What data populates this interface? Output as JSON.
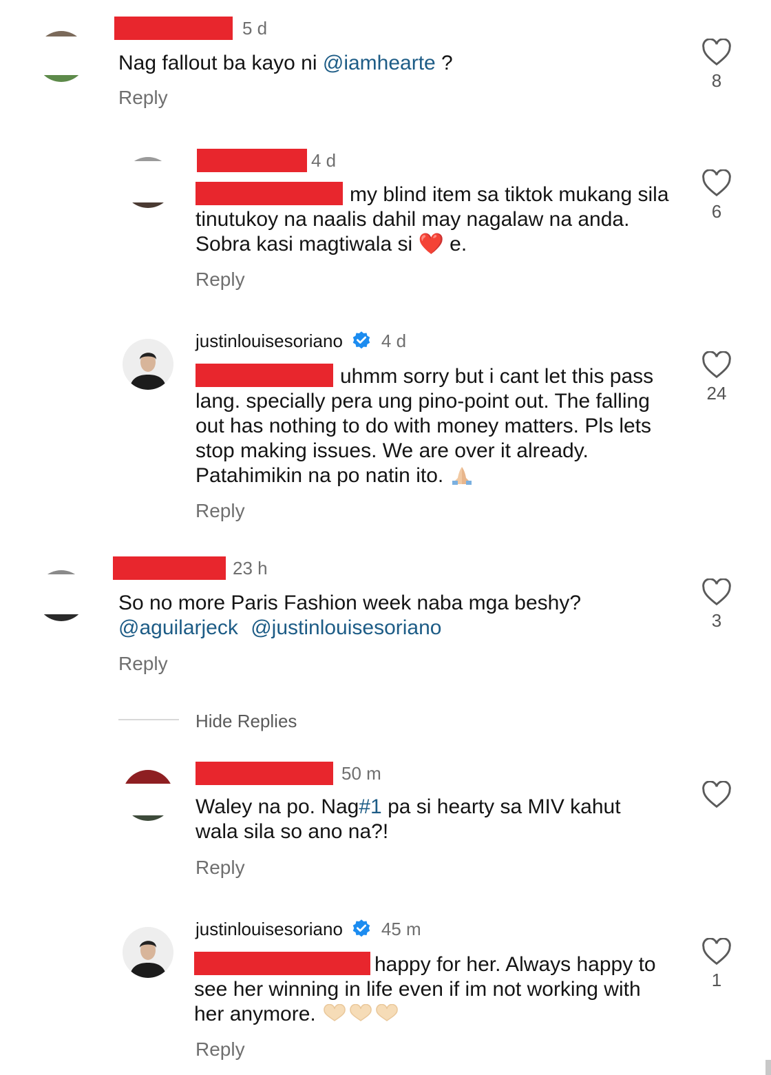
{
  "comments": [
    {
      "time": "5 d",
      "text": "Nag fallout ba kayo ni ",
      "mention": "@iamhearte",
      "text_after": " ?",
      "reply_label": "Reply",
      "likes": "8"
    },
    {
      "time": "4 d",
      "text_line": "my blind item sa tiktok mukang sila tinutukoy na naalis dahil may nagalaw na anda. Sobra kasi magtiwala si ",
      "emoji": "❤️",
      "text_after": " e.",
      "reply_label": "Reply",
      "likes": "6"
    },
    {
      "username": "justinlouisesoriano",
      "time": "4 d",
      "text": "uhmm sorry but i cant let this pass lang. specially pera ung pino-point out. The falling out has nothing to do with money matters. Pls lets stop making issues. We are over it already. Patahimikin na po natin ito.",
      "reply_label": "Reply",
      "likes": "24"
    },
    {
      "time": "23 h",
      "text": "So no more Paris Fashion week naba mga beshy?",
      "mention1": "@aguilarjeck",
      "mention2": "@justinlouisesoriano",
      "reply_label": "Reply",
      "likes": "3"
    },
    {
      "time": "50 m",
      "text_before": "Waley na po. Nag",
      "hashtag": "#1",
      "text_after": " pa si hearty sa MIV kahut wala sila so ano na?!",
      "reply_label": "Reply"
    },
    {
      "username": "justinlouisesoriano",
      "time": "45 m",
      "text": "happy for her. Always happy to see her winning in life even if im not working with her anymore.",
      "reply_label": "Reply",
      "likes": "1"
    }
  ],
  "hide_replies": "Hide Replies",
  "icons": {
    "like": "heart-outline-icon",
    "verified": "verified-badge-icon"
  },
  "colors": {
    "redaction": "#e8262d",
    "mention": "#1d5c86",
    "verified": "#1c8cf0"
  }
}
